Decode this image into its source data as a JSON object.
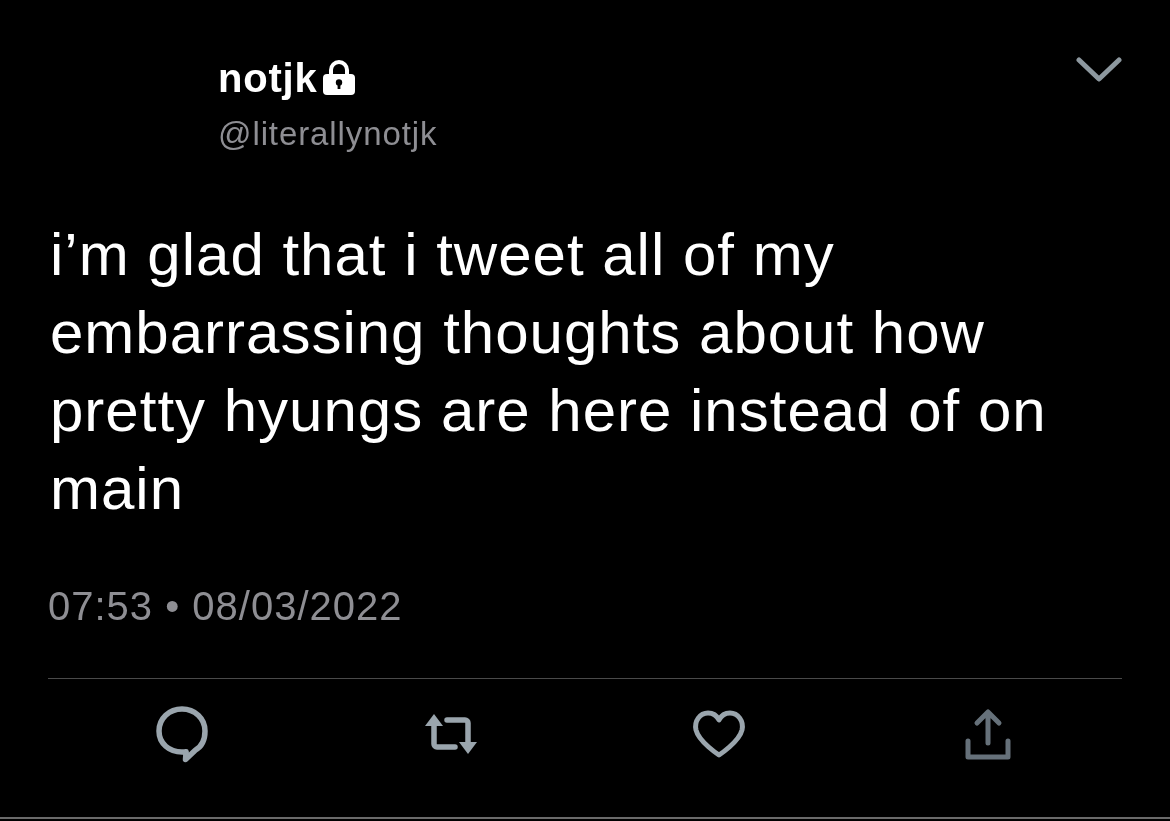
{
  "header": {
    "display_name": "notjk",
    "protected": true,
    "handle": "@literallynotjk"
  },
  "tweet": {
    "text": "i’m glad that i tweet all of my embarrassing thoughts about how pretty hyungs are here instead of on main",
    "timestamp": "07:53 • 08/03/2022"
  },
  "actions": [
    {
      "kind": "reply"
    },
    {
      "kind": "retweet"
    },
    {
      "kind": "like"
    },
    {
      "kind": "share"
    }
  ]
}
